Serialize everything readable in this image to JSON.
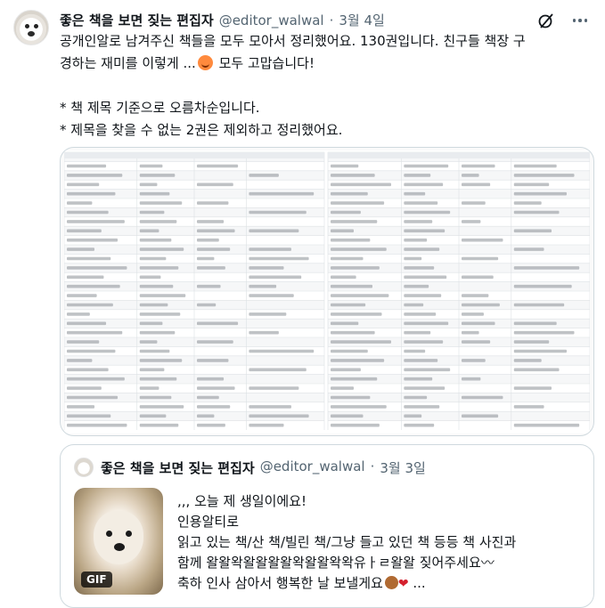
{
  "tweet": {
    "display_name": "좋은 책을 보면 짖는 편집자",
    "handle": "@editor_walwal",
    "separator": "·",
    "date": "3월 4일",
    "lines": [
      "공개인알로 남겨주신 책들을 모두 모아서 정리했어요. 130권입니다. 친구들 책장 구",
      "경하는 재미를 이렇게 ...",
      "",
      "* 책 제목 기준으로 오름차순입니다.",
      "* 제목을 찾을 수 없는 2권은 제외하고 정리했어요."
    ],
    "line2_suffix": " 모두 고맙습니다!"
  },
  "icons": {
    "grok": "grok-icon",
    "more": "more-icon",
    "smile": "smiling-face-emoji",
    "dog": "dog-face-emoji",
    "heart": "red-heart-emoji"
  },
  "quote": {
    "display_name": "좋은 책을 보면 짖는 편집자",
    "handle": "@editor_walwal",
    "separator": "·",
    "date": "3월 3일",
    "gif_label": "GIF",
    "lines": [
      ",,, 오늘 제 생일이에요!",
      "인용알티로",
      "읽고 있는 책/산 책/빌린 책/그냥 들고 있던 책 등등 책 사진과",
      "함께 왈왈왁왈왈왈왈왁왈왈왁왁유ㅏㄹ왈왈 짖어주세요〰",
      "축하 인사 삼아서 행복한 날 보낼게요"
    ],
    "last_suffix": " ..."
  },
  "colors": {
    "text": "#0f1419",
    "muted": "#536471",
    "border": "#cfd9de"
  }
}
